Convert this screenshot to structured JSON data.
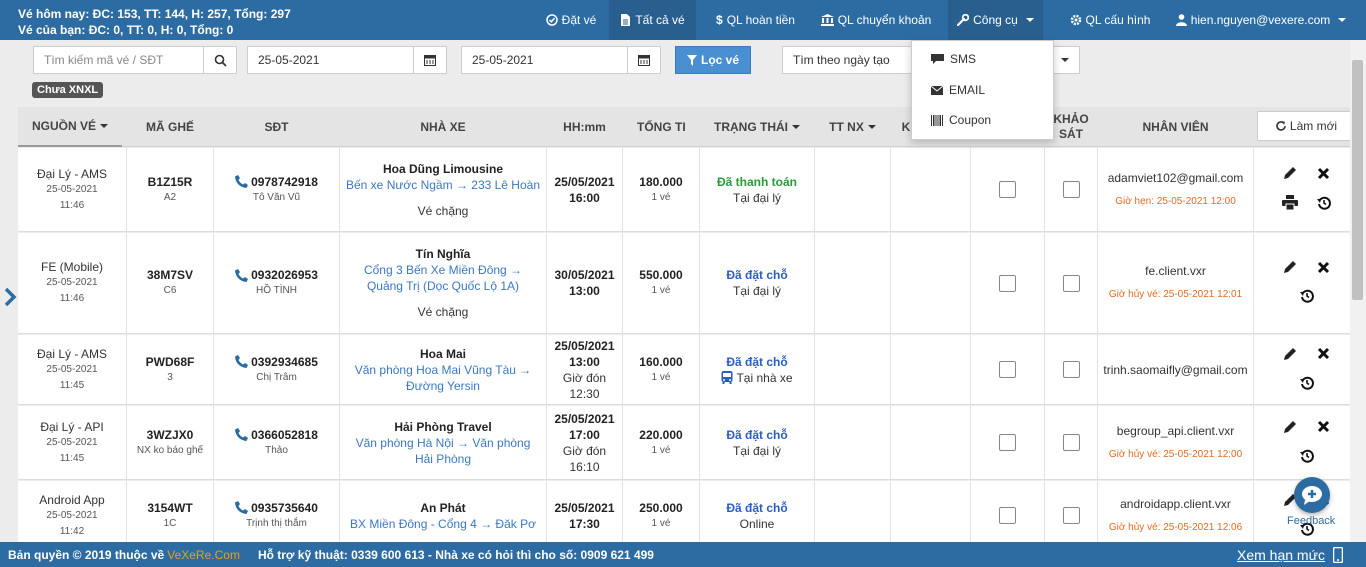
{
  "header": {
    "stats_line1": "Vé hôm nay: ĐC: 153, TT: 144, H: 257, Tổng: 297",
    "stats_line2": "Vé của bạn: ĐC: 0, TT: 0, H: 0, Tổng: 0",
    "nav": {
      "dat_ve": "Đặt vé",
      "tat_ca_ve": "Tất cả vé",
      "ql_hoan_tien": "QL hoàn tiền",
      "ql_chuyen_khoan": "QL chuyển khoản",
      "cong_cu": "Công cụ",
      "ql_cau_hinh": "QL cấu hình",
      "user": "hien.nguyen@vexere.com"
    }
  },
  "filters": {
    "search_placeholder": "Tìm kiếm mã vé / SĐT",
    "date_from": "25-05-2021",
    "date_to": "25-05-2021",
    "filter_button": "Lọc vé",
    "search_type": "Tìm theo ngày tạo",
    "badge": "Chưa XNXL"
  },
  "tools_menu": {
    "items": [
      "SMS",
      "EMAIL",
      "Coupon"
    ]
  },
  "table": {
    "headers": {
      "nguon_ve": "NGUỒN VÉ",
      "ma_ghe": "MÃ GHẾ",
      "sdt": "SĐT",
      "nha_xe": "NHÀ XE",
      "hhmm": "HH:mm",
      "tong_tien": "TỔNG TI",
      "trang_thai": "TRẠNG THÁI",
      "tt_nx": "TT NX",
      "k": "K",
      "khao_sat_1": "KHẢO",
      "khao_sat_2": "SÁT",
      "nhan_vien": "NHÂN VIÊN",
      "lam_moi": "Làm mới"
    },
    "rows": [
      {
        "source": "Đại Lý - AMS",
        "date": "25-05-2021",
        "time": "11:46",
        "code": "B1Z15R",
        "seat": "A2",
        "phone": "0978742918",
        "name": "Tô Văn Vũ",
        "company": "Hoa Dũng Limousine",
        "route": "Bến xe Nước Ngầm → 233 Lê Hoàn",
        "note": "Vé chặng",
        "dep_date": "25/05/2021",
        "dep_time": "16:00",
        "pickup_label": "",
        "pickup_time": "",
        "amount": "180.000",
        "qty": "1 vé",
        "status": "Đã thanh toán",
        "status_sub": "Tại đại lý",
        "staff": "adamviet102@gmail.com",
        "staff_note": "Giờ hẹn: 25-05-2021 12:00"
      },
      {
        "source": "FE (Mobile)",
        "date": "25-05-2021",
        "time": "11:46",
        "code": "38M7SV",
        "seat": "C6",
        "phone": "0932026953",
        "name": "HỒ TÌNH",
        "company": "Tín Nghĩa",
        "route": "Cổng 3 Bến Xe Miền Đông → Quảng Trị (Dọc Quốc Lộ 1A)",
        "note": "Vé chặng",
        "dep_date": "30/05/2021",
        "dep_time": "13:00",
        "pickup_label": "",
        "pickup_time": "",
        "amount": "550.000",
        "qty": "1 vé",
        "status": "Đã đặt chỗ",
        "status_sub": "Tại đại lý",
        "staff": "fe.client.vxr",
        "staff_note": "Giờ hủy vé: 25-05-2021 12:01"
      },
      {
        "source": "Đại Lý - AMS",
        "date": "25-05-2021",
        "time": "11:45",
        "code": "PWD68F",
        "seat": "3",
        "phone": "0392934685",
        "name": "Chị Trâm",
        "company": "Hoa Mai",
        "route": "Văn phòng Hoa Mai Vũng Tàu → Đường Yersin",
        "note": "",
        "dep_date": "25/05/2021",
        "dep_time": "13:00",
        "pickup_label": "Giờ đón",
        "pickup_time": "12:30",
        "amount": "160.000",
        "qty": "1 vé",
        "status": "Đã đặt chỗ",
        "status_sub": "Tại nhà xe",
        "staff": "trinh.saomaifly@gmail.com",
        "staff_note": ""
      },
      {
        "source": "Đại Lý - API",
        "date": "25-05-2021",
        "time": "11:45",
        "code": "3WZJX0",
        "seat": "NX ko báo ghế",
        "phone": "0366052818",
        "name": "Thảo",
        "company": "Hải Phòng Travel",
        "route": "Văn phòng Hà Nội → Văn phòng Hải Phòng",
        "note": "",
        "dep_date": "25/05/2021",
        "dep_time": "17:00",
        "pickup_label": "Giờ đón",
        "pickup_time": "16:10",
        "amount": "220.000",
        "qty": "1 vé",
        "status": "Đã đặt chỗ",
        "status_sub": "Tại đại lý",
        "staff": "begroup_api.client.vxr",
        "staff_note": "Giờ hủy vé: 25-05-2021 12:00"
      },
      {
        "source": "Android App",
        "date": "25-05-2021",
        "time": "11:42",
        "code": "3154WT",
        "seat": "1C",
        "phone": "0935735640",
        "name": "Trịnh thị thắm",
        "company": "An Phát",
        "route": "BX Miền Đông - Cổng 4 → Đăk Pơ",
        "note": "",
        "dep_date": "25/05/2021",
        "dep_time": "17:30",
        "pickup_label": "",
        "pickup_time": "",
        "amount": "250.000",
        "qty": "1 vé",
        "status": "Đã đặt chỗ",
        "status_sub": "Online",
        "staff": "androidapp.client.vxr",
        "staff_note": "Giờ hủy vé: 25-05-2021 12:06"
      }
    ]
  },
  "footer": {
    "copyright": "Bản quyền © 2019 thuộc về ",
    "brand": "VeXeRe.Com",
    "support": "Hỗ trợ kỹ thuật: 0339 600 613 - Nhà xe có hỏi thì cho số: 0909 621 499",
    "limit_link": "Xem hạn mức"
  },
  "feedback": {
    "label": "Feedback"
  },
  "colors": {
    "primary": "#2d6ca2",
    "brand_orange": "#f39c12",
    "paid_green": "#2a9a3a",
    "booked_blue": "#2a5dc4",
    "note_orange": "#e46a1f"
  }
}
